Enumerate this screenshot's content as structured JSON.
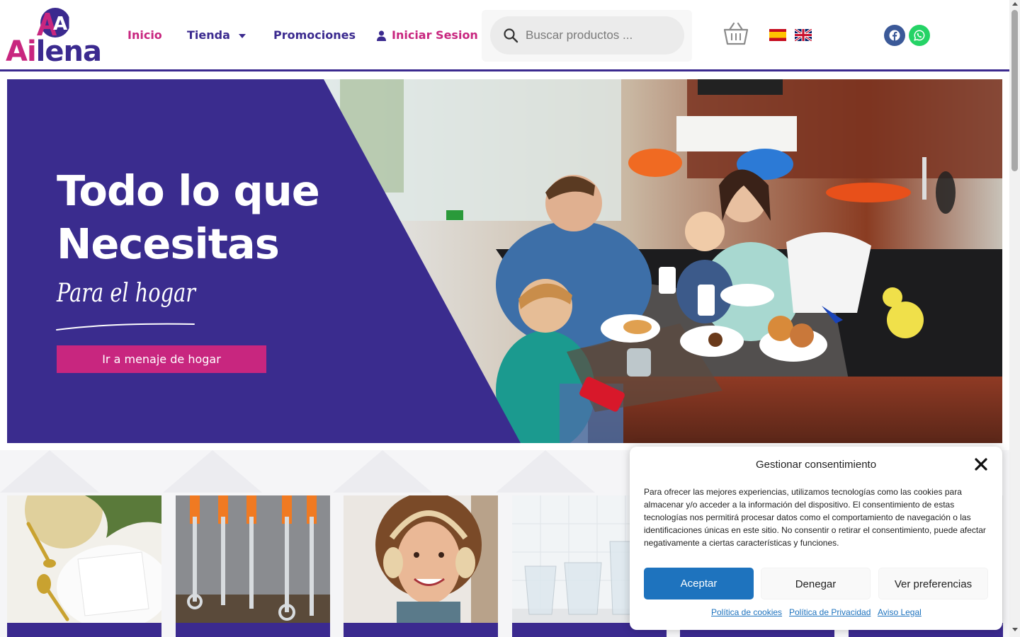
{
  "brand": {
    "logo_text_a": "Ai",
    "logo_text_b": "lena",
    "logo_mark": "AE",
    "primary_color": "#3b2a8f",
    "accent_color": "#c8267f"
  },
  "nav": {
    "items": [
      {
        "label": "Inicio",
        "active": true
      },
      {
        "label": "Tienda",
        "has_dropdown": true
      },
      {
        "label": "Promociones"
      },
      {
        "label": "Iniciar Sesion",
        "icon": "user-icon"
      }
    ]
  },
  "search": {
    "placeholder": "Buscar productos ..."
  },
  "icons": {
    "cart": "shopping-basket-icon",
    "lang_es": "spain-flag-icon",
    "lang_en": "uk-flag-icon",
    "facebook": "facebook-icon",
    "whatsapp": "whatsapp-icon"
  },
  "hero": {
    "title": "Todo lo que Necesitas",
    "subtitle": "Para el hogar",
    "button_label": "Ir a menaje de hogar"
  },
  "categories": [
    {
      "image": "table-setting-photo"
    },
    {
      "image": "wrenches-photo"
    },
    {
      "image": "headphones-woman-photo"
    },
    {
      "image": "glasses-photo"
    },
    {
      "image": "category-photo"
    },
    {
      "image": "category-photo"
    }
  ],
  "cookie_modal": {
    "title": "Gestionar consentimiento",
    "body": "Para ofrecer las mejores experiencias, utilizamos tecnologías como las cookies para almacenar y/o acceder a la información del dispositivo. El consentimiento de estas tecnologías nos permitirá procesar datos como el comportamiento de navegación o las identificaciones únicas en este sitio. No consentir o retirar el consentimiento, puede afectar negativamente a ciertas características y funciones.",
    "accept_label": "Aceptar",
    "deny_label": "Denegar",
    "prefs_label": "Ver preferencias",
    "links": [
      "Política de cookies",
      "Política de Privacidad",
      "Aviso Legal"
    ]
  }
}
